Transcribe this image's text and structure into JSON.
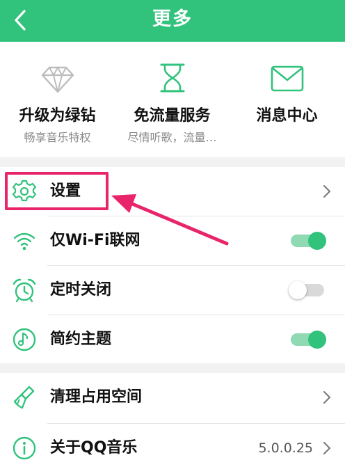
{
  "colors": {
    "brand": "#31c27c",
    "annotation": "#e8246b"
  },
  "header": {
    "title": "更多",
    "back_icon": "chevron-left-icon"
  },
  "features": [
    {
      "icon": "diamond-icon",
      "title": "升级为绿钻",
      "subtitle": "畅享音乐特权"
    },
    {
      "icon": "hourglass-icon",
      "title": "免流量服务",
      "subtitle": "尽情听歌，流量…"
    },
    {
      "icon": "envelope-icon",
      "title": "消息中心",
      "subtitle": ""
    }
  ],
  "settings_group": [
    {
      "icon": "gear-icon",
      "label": "设置",
      "control": "chevron"
    },
    {
      "icon": "wifi-icon",
      "label": "仅Wi-Fi联网",
      "control": "toggle",
      "on": true
    },
    {
      "icon": "alarm-clock-icon",
      "label": "定时关闭",
      "control": "toggle",
      "on": false
    },
    {
      "icon": "theme-icon",
      "label": "简约主题",
      "control": "toggle",
      "on": true
    }
  ],
  "misc_group": [
    {
      "icon": "brush-icon",
      "label": "清理占用空间",
      "control": "chevron"
    },
    {
      "icon": "info-icon",
      "label": "关于QQ音乐",
      "value": "5.0.0.25",
      "control": "chevron"
    }
  ]
}
